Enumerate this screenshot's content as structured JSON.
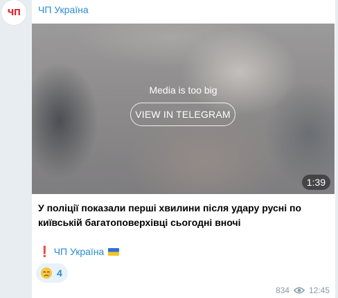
{
  "channel": {
    "name": "ЧП Україна",
    "avatar_text": "ЧП"
  },
  "media": {
    "notice": "Media is too big",
    "button_label": "VIEW IN TELEGRAM",
    "duration": "1:39"
  },
  "post": {
    "caption": "У поліції показали перші хвилини після удару русні по київській багатоповерхівці сьогодні вночі",
    "signature_icon": "red-exclamation",
    "signature_link": "ЧП Україна",
    "signature_flag": "ukraine-flag"
  },
  "reaction": {
    "emoji": "crying-face",
    "count": "4"
  },
  "footer": {
    "views": "834",
    "views_icon": "eye-icon",
    "time": "12:45"
  },
  "colors": {
    "accent": "#2a8acf",
    "background": "#e8edf1",
    "bubble": "#ffffff"
  }
}
